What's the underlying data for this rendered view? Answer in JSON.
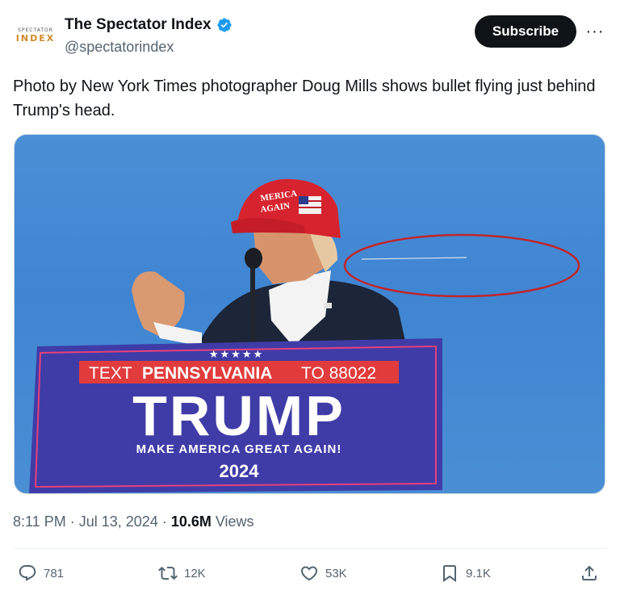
{
  "account": {
    "avatar_top": "SPECTATOR",
    "avatar_bottom": "INDEX",
    "name": "The Spectator Index",
    "handle": "@spectatorindex"
  },
  "header": {
    "subscribe_label": "Subscribe",
    "more_label": "···"
  },
  "tweet": {
    "text": "Photo by New York Times photographer Doug Mills shows bullet flying just behind Trump's head."
  },
  "photo": {
    "hat_text_1": "MERICA",
    "hat_text_2": "AGAIN",
    "stars": "★★★★★",
    "banner_text_1": "TEXT",
    "banner_text_2": "PENNSYLVANIA",
    "banner_text_3": "TO 88022",
    "podium_main": "TRUMP",
    "podium_slogan": "MAKE AMERICA GREAT AGAIN!",
    "podium_year": "2024"
  },
  "meta": {
    "time": "8:11 PM",
    "date": "Jul 13, 2024",
    "views_count": "10.6M",
    "views_label": "Views"
  },
  "actions": {
    "replies": "781",
    "reposts": "12K",
    "likes": "53K",
    "bookmarks": "9.1K"
  },
  "colors": {
    "subscribe_bg": "#0f1419",
    "verified": "#1d9bf0",
    "sky": "#4a8fd4",
    "podium": "#3f3ca8",
    "banner_red": "#e23b3b",
    "circle": "#c0262b"
  }
}
